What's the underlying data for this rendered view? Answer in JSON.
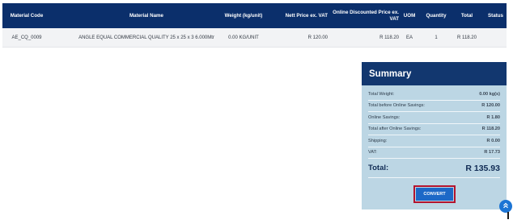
{
  "table": {
    "headers": {
      "material_code": "Material Code",
      "material_name": "Material Name",
      "weight": "Weight (kg/unit)",
      "nett_price": "Nett Price ex. VAT",
      "online_discounted_price": "Online Discounted Price ex. VAT",
      "uom": "UOM",
      "quantity": "Quantity",
      "total": "Total",
      "status": "Status"
    },
    "rows": [
      {
        "material_code": "AE_CQ_0009",
        "material_name": "ANGLE EQUAL COMMERCIAL QUALITY 25 x 25 x 3 6.000Mtr",
        "weight": "0.00 KG/UNIT",
        "nett_price": "R 120.00",
        "online_discounted_price": "R 118.20",
        "uom": "EA",
        "quantity": "1",
        "total": "R 118.20",
        "status": ""
      }
    ]
  },
  "summary": {
    "title": "Summary",
    "rows": [
      {
        "label": "Total Weight:",
        "value": "0.00 kg(s)"
      },
      {
        "label": "Total before Online Savings:",
        "value": "R 120.00"
      },
      {
        "label": "Online Savings:",
        "value": "R 1.80"
      },
      {
        "label": "Total after Online Savings:",
        "value": "R 118.20"
      },
      {
        "label": "Shipping:",
        "value": "R 0.00"
      },
      {
        "label": "VAT:",
        "value": "R 17.73"
      }
    ],
    "total_label": "Total:",
    "total_value": "R 135.93",
    "convert_label": "CONVERT"
  },
  "scroll_top_icon": "double-chevron-up-icon",
  "colors": {
    "header_bg": "#0b2f6b",
    "summary_bg": "#bcd6e4",
    "summary_head_bg": "#12376f",
    "button_bg": "#1c68c7",
    "highlight_border": "#b3142e"
  }
}
